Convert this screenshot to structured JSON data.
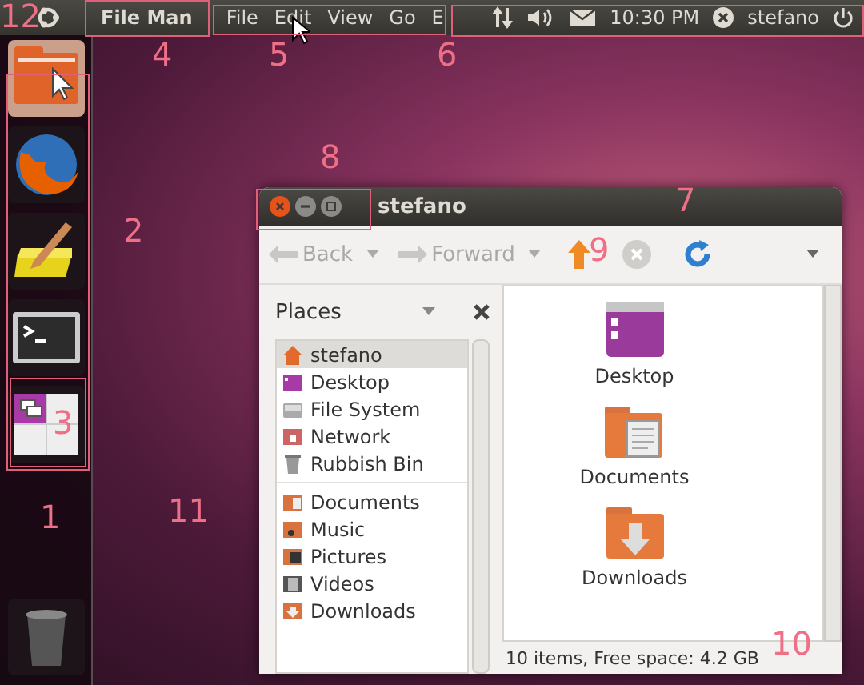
{
  "top_panel": {
    "app_title": "File Man",
    "menus": [
      "File",
      "Edit",
      "View",
      "Go",
      "E"
    ],
    "clock": "10:30 PM",
    "user": "stefano"
  },
  "window": {
    "title": "stefano",
    "toolbar": {
      "nav": [
        {
          "label": "Back",
          "disabled": true
        },
        {
          "label": "Forward",
          "disabled": true
        }
      ],
      "icon_buttons": [
        {
          "kind": "up",
          "disabled": false
        },
        {
          "kind": "stop",
          "disabled": true
        },
        {
          "kind": "reload",
          "disabled": false
        }
      ]
    },
    "sidebar": {
      "title": "Places",
      "groups": [
        [
          {
            "label": "stefano",
            "selected": true
          },
          {
            "label": "Desktop",
            "selected": false
          },
          {
            "label": "File System",
            "selected": false
          },
          {
            "label": "Network",
            "selected": false
          },
          {
            "label": "Rubbish Bin",
            "selected": false
          }
        ],
        [
          {
            "label": "Documents",
            "selected": false
          },
          {
            "label": "Music",
            "selected": false
          },
          {
            "label": "Pictures",
            "selected": false
          },
          {
            "label": "Videos",
            "selected": false
          },
          {
            "label": "Downloads",
            "selected": false
          }
        ]
      ]
    },
    "files": [
      {
        "name": "Desktop"
      },
      {
        "name": "Documents"
      },
      {
        "name": "Downloads"
      }
    ],
    "status_bar": "10 items, Free space: 4.2 GB"
  },
  "annotations": [
    "12",
    "4",
    "5",
    "6",
    "2",
    "8",
    "7",
    "3",
    "9",
    "1",
    "11",
    "10"
  ]
}
